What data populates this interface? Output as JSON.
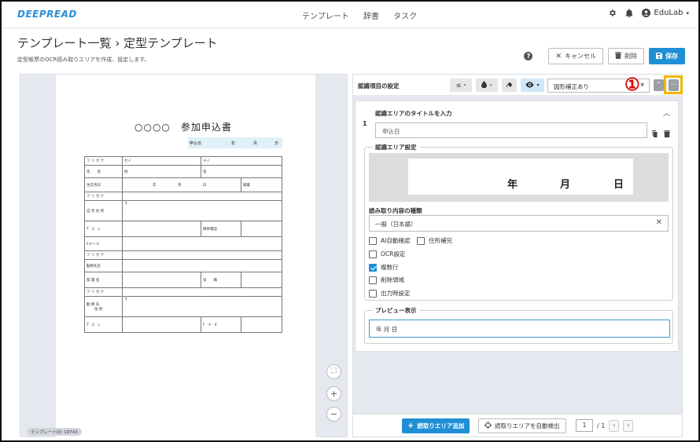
{
  "nav": {
    "logo": "DEEPREAD",
    "links": [
      "テンプレート",
      "辞書",
      "タスク"
    ],
    "user": "EduLab"
  },
  "header": {
    "breadcrumb": "テンプレート一覧 › 定型テンプレート",
    "subtitle": "定型帳票のOCR読み取りエリアを作成、設定します。",
    "help": "?",
    "cancel_label": "キャンセル",
    "delete_label": "削除",
    "save_label": "保存"
  },
  "document": {
    "title": "○○○○　参加申込書",
    "apply_date_label": "申込日",
    "apply_date_year": "年",
    "apply_date_month": "月",
    "apply_date_day": "日",
    "rows": {
      "furigana": "フ リ ガ ナ",
      "sei": "セイ",
      "mei": "メイ",
      "name": "氏　　名",
      "sei_kanji": "姓",
      "mei_kanji": "名",
      "birthday": "生年月日",
      "year": "年",
      "month": "月",
      "day": "日",
      "occupation": "職業",
      "furigana2": "フ リ ガ ナ",
      "address": "自 宅 住 所",
      "postal": "〒",
      "tel": "T　E　L",
      "mobile": "携帯電話",
      "email": "Eメール",
      "furigana3": "フ リ ガ ナ",
      "work_name": "勤務先名",
      "dept": "部 署 名",
      "position": "役　　職",
      "furigana4": "フ リ ガ ナ",
      "work_addr_1": "勤 務 先",
      "work_addr_2": "住 所",
      "postal2": "〒",
      "tel2": "T　E　L",
      "fax": "F　A　X"
    },
    "template_id": "テンプレートID: 19743",
    "zoom_fit": "⛶",
    "zoom_in": "+",
    "zoom_out": "−"
  },
  "panel": {
    "title": "認識項目の設定",
    "tool_sort": "≤",
    "correction_select": "図形補正あり",
    "annotation_number": "①",
    "item_number": "1",
    "item_title": "認識エリアのタイトルを入力",
    "item_name": "申込日",
    "area_settings_legend": "認識エリア設定",
    "preview_year": "年",
    "preview_month": "月",
    "preview_day": "日",
    "read_type_label": "読み取り内容の種類",
    "read_type_value": "一般（日本語）",
    "options": [
      {
        "label": "AI自動確認",
        "checked": false
      },
      {
        "label": "住所補完",
        "checked": false
      },
      {
        "label": "OCR設定",
        "checked": false
      },
      {
        "label": "複数行",
        "checked": true
      },
      {
        "label": "削除領域",
        "checked": false
      },
      {
        "label": "出力時設定",
        "checked": false
      }
    ],
    "preview_legend": "プレビュー表示",
    "preview_value": "年 月 日"
  },
  "footer": {
    "add_label": "読取りエリア追加",
    "auto_label": "読取りエリアを自動検出",
    "page_current": "1",
    "page_total": "/ 1"
  },
  "colors": {
    "accent": "#1f8fd6",
    "highlight": "#f0b400",
    "annotation": "#dd0000"
  }
}
